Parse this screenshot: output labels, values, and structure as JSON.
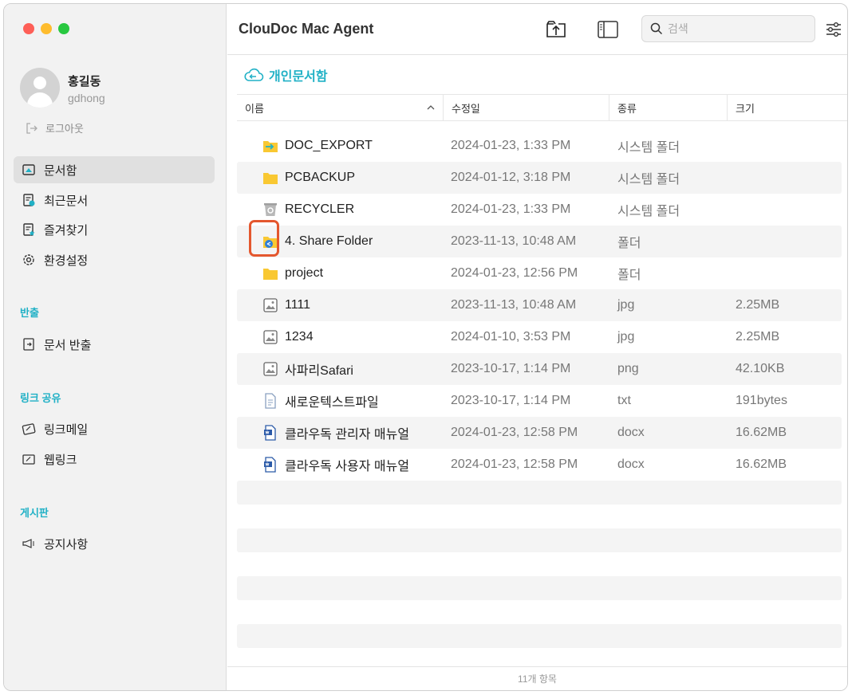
{
  "app": {
    "title": "ClouDoc Mac Agent"
  },
  "user": {
    "name": "홍길동",
    "id": "gdhong",
    "logout_label": "로그아웃"
  },
  "sidebar": {
    "main_items": [
      {
        "label": "문서함",
        "icon": "drawer-icon",
        "active": true
      },
      {
        "label": "최근문서",
        "icon": "recent-doc-icon"
      },
      {
        "label": "즐겨찾기",
        "icon": "star-doc-icon"
      },
      {
        "label": "환경설정",
        "icon": "gear-icon"
      }
    ],
    "sections": [
      {
        "title": "반출",
        "items": [
          {
            "label": "문서 반출",
            "icon": "export-icon"
          }
        ]
      },
      {
        "title": "링크 공유",
        "items": [
          {
            "label": "링크메일",
            "icon": "link-mail-icon"
          },
          {
            "label": "웹링크",
            "icon": "web-link-icon"
          }
        ]
      },
      {
        "title": "게시판",
        "items": [
          {
            "label": "공지사항",
            "icon": "megaphone-icon"
          }
        ]
      }
    ]
  },
  "toolbar": {
    "upload_icon": "upload-icon",
    "sidebar_toggle_icon": "sidebar-toggle-icon",
    "search_placeholder": "검색",
    "filter_icon": "filter-sliders-icon"
  },
  "breadcrumb": {
    "label": "개인문서함",
    "icon": "cloud-back-icon"
  },
  "columns": {
    "name": "이름",
    "modified": "수정일",
    "kind": "종류",
    "size": "크기",
    "sort": "ascending"
  },
  "files": [
    {
      "name": "DOC_EXPORT",
      "date": "2024-01-23, 1:33 PM",
      "kind": "시스템 폴더",
      "size": "",
      "icon": "export-folder-icon"
    },
    {
      "name": "PCBACKUP",
      "date": "2024-01-12, 3:18 PM",
      "kind": "시스템 폴더",
      "size": "",
      "icon": "folder-icon"
    },
    {
      "name": "RECYCLER",
      "date": "2024-01-23, 1:33 PM",
      "kind": "시스템 폴더",
      "size": "",
      "icon": "recycle-bin-icon"
    },
    {
      "name": "4. Share Folder",
      "date": "2023-11-13, 10:48 AM",
      "kind": "폴더",
      "size": "",
      "icon": "shared-folder-icon"
    },
    {
      "name": "project",
      "date": "2024-01-23, 12:56 PM",
      "kind": "폴더",
      "size": "",
      "icon": "folder-icon"
    },
    {
      "name": "1111",
      "date": "2023-11-13, 10:48 AM",
      "kind": "jpg",
      "size": "2.25MB",
      "icon": "image-file-icon"
    },
    {
      "name": "1234",
      "date": "2024-01-10, 3:53 PM",
      "kind": "jpg",
      "size": "2.25MB",
      "icon": "image-file-icon"
    },
    {
      "name": "사파리Safari",
      "date": "2023-10-17, 1:14 PM",
      "kind": "png",
      "size": "42.10KB",
      "icon": "image-file-icon"
    },
    {
      "name": "새로운텍스트파일",
      "date": "2023-10-17, 1:14 PM",
      "kind": "txt",
      "size": "191bytes",
      "icon": "text-file-icon"
    },
    {
      "name": "클라우독 관리자 매뉴얼",
      "date": "2024-01-23, 12:58 PM",
      "kind": "docx",
      "size": "16.62MB",
      "icon": "docx-file-icon"
    },
    {
      "name": "클라우독 사용자 매뉴얼",
      "date": "2024-01-23, 12:58 PM",
      "kind": "docx",
      "size": "16.62MB",
      "icon": "docx-file-icon"
    }
  ],
  "footer": {
    "count_label": "11개 항목"
  },
  "colors": {
    "accent": "#21b1c6",
    "highlight": "#e4572e",
    "folder": "#f9c832"
  }
}
